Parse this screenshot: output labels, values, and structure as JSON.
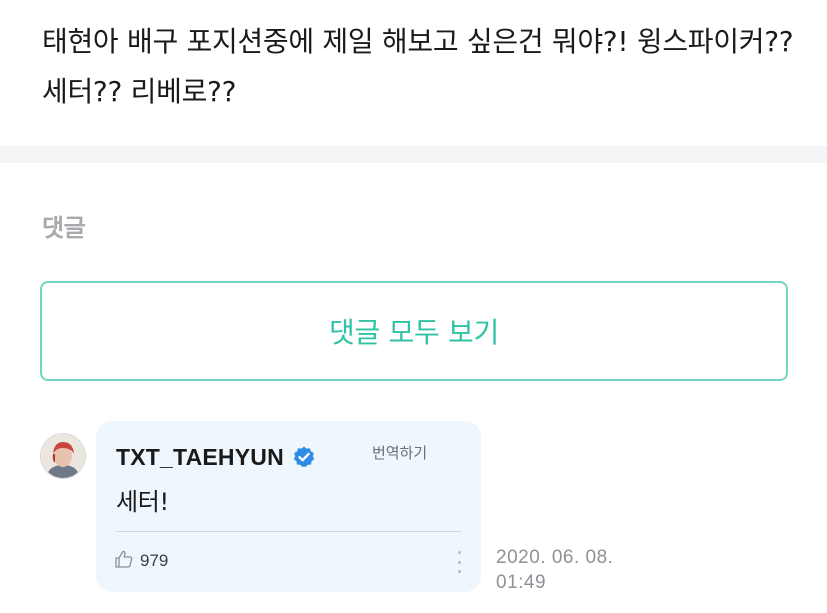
{
  "post": {
    "text": "태현아 배구 포지션중에 제일 해보고 싶은건 뭐야?! 윙스파이커?? 세터?? 리베로??"
  },
  "comments": {
    "heading": "댓글",
    "view_all_label": "댓글 모두 보기",
    "items": [
      {
        "author": "TXT_TAEHYUN",
        "verified": true,
        "translate_label": "번역하기",
        "text": "세터!",
        "likes": "979",
        "date": "2020. 06. 08.",
        "time": "01:49"
      }
    ]
  },
  "colors": {
    "accent": "#30c2a4",
    "accent_border": "#73d5c2",
    "bubble_bg": "#eef7fd",
    "verified_badge": "#2f8ce6"
  },
  "icons": {
    "like": "thumbs-up-icon",
    "verified": "verified-check-icon",
    "more": "more-vertical-icon"
  }
}
